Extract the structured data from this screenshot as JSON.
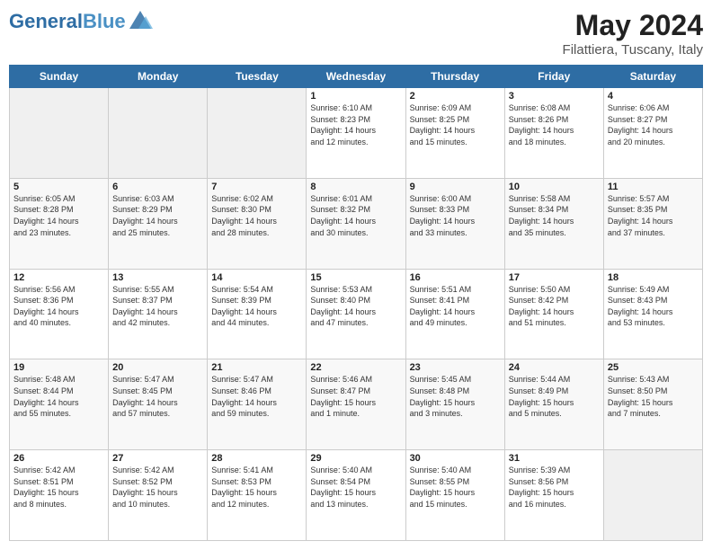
{
  "logo": {
    "part1": "General",
    "part2": "Blue"
  },
  "title": "May 2024",
  "location": "Filattiera, Tuscany, Italy",
  "days_header": [
    "Sunday",
    "Monday",
    "Tuesday",
    "Wednesday",
    "Thursday",
    "Friday",
    "Saturday"
  ],
  "weeks": [
    [
      {
        "num": "",
        "info": ""
      },
      {
        "num": "",
        "info": ""
      },
      {
        "num": "",
        "info": ""
      },
      {
        "num": "1",
        "info": "Sunrise: 6:10 AM\nSunset: 8:23 PM\nDaylight: 14 hours\nand 12 minutes."
      },
      {
        "num": "2",
        "info": "Sunrise: 6:09 AM\nSunset: 8:25 PM\nDaylight: 14 hours\nand 15 minutes."
      },
      {
        "num": "3",
        "info": "Sunrise: 6:08 AM\nSunset: 8:26 PM\nDaylight: 14 hours\nand 18 minutes."
      },
      {
        "num": "4",
        "info": "Sunrise: 6:06 AM\nSunset: 8:27 PM\nDaylight: 14 hours\nand 20 minutes."
      }
    ],
    [
      {
        "num": "5",
        "info": "Sunrise: 6:05 AM\nSunset: 8:28 PM\nDaylight: 14 hours\nand 23 minutes."
      },
      {
        "num": "6",
        "info": "Sunrise: 6:03 AM\nSunset: 8:29 PM\nDaylight: 14 hours\nand 25 minutes."
      },
      {
        "num": "7",
        "info": "Sunrise: 6:02 AM\nSunset: 8:30 PM\nDaylight: 14 hours\nand 28 minutes."
      },
      {
        "num": "8",
        "info": "Sunrise: 6:01 AM\nSunset: 8:32 PM\nDaylight: 14 hours\nand 30 minutes."
      },
      {
        "num": "9",
        "info": "Sunrise: 6:00 AM\nSunset: 8:33 PM\nDaylight: 14 hours\nand 33 minutes."
      },
      {
        "num": "10",
        "info": "Sunrise: 5:58 AM\nSunset: 8:34 PM\nDaylight: 14 hours\nand 35 minutes."
      },
      {
        "num": "11",
        "info": "Sunrise: 5:57 AM\nSunset: 8:35 PM\nDaylight: 14 hours\nand 37 minutes."
      }
    ],
    [
      {
        "num": "12",
        "info": "Sunrise: 5:56 AM\nSunset: 8:36 PM\nDaylight: 14 hours\nand 40 minutes."
      },
      {
        "num": "13",
        "info": "Sunrise: 5:55 AM\nSunset: 8:37 PM\nDaylight: 14 hours\nand 42 minutes."
      },
      {
        "num": "14",
        "info": "Sunrise: 5:54 AM\nSunset: 8:39 PM\nDaylight: 14 hours\nand 44 minutes."
      },
      {
        "num": "15",
        "info": "Sunrise: 5:53 AM\nSunset: 8:40 PM\nDaylight: 14 hours\nand 47 minutes."
      },
      {
        "num": "16",
        "info": "Sunrise: 5:51 AM\nSunset: 8:41 PM\nDaylight: 14 hours\nand 49 minutes."
      },
      {
        "num": "17",
        "info": "Sunrise: 5:50 AM\nSunset: 8:42 PM\nDaylight: 14 hours\nand 51 minutes."
      },
      {
        "num": "18",
        "info": "Sunrise: 5:49 AM\nSunset: 8:43 PM\nDaylight: 14 hours\nand 53 minutes."
      }
    ],
    [
      {
        "num": "19",
        "info": "Sunrise: 5:48 AM\nSunset: 8:44 PM\nDaylight: 14 hours\nand 55 minutes."
      },
      {
        "num": "20",
        "info": "Sunrise: 5:47 AM\nSunset: 8:45 PM\nDaylight: 14 hours\nand 57 minutes."
      },
      {
        "num": "21",
        "info": "Sunrise: 5:47 AM\nSunset: 8:46 PM\nDaylight: 14 hours\nand 59 minutes."
      },
      {
        "num": "22",
        "info": "Sunrise: 5:46 AM\nSunset: 8:47 PM\nDaylight: 15 hours\nand 1 minute."
      },
      {
        "num": "23",
        "info": "Sunrise: 5:45 AM\nSunset: 8:48 PM\nDaylight: 15 hours\nand 3 minutes."
      },
      {
        "num": "24",
        "info": "Sunrise: 5:44 AM\nSunset: 8:49 PM\nDaylight: 15 hours\nand 5 minutes."
      },
      {
        "num": "25",
        "info": "Sunrise: 5:43 AM\nSunset: 8:50 PM\nDaylight: 15 hours\nand 7 minutes."
      }
    ],
    [
      {
        "num": "26",
        "info": "Sunrise: 5:42 AM\nSunset: 8:51 PM\nDaylight: 15 hours\nand 8 minutes."
      },
      {
        "num": "27",
        "info": "Sunrise: 5:42 AM\nSunset: 8:52 PM\nDaylight: 15 hours\nand 10 minutes."
      },
      {
        "num": "28",
        "info": "Sunrise: 5:41 AM\nSunset: 8:53 PM\nDaylight: 15 hours\nand 12 minutes."
      },
      {
        "num": "29",
        "info": "Sunrise: 5:40 AM\nSunset: 8:54 PM\nDaylight: 15 hours\nand 13 minutes."
      },
      {
        "num": "30",
        "info": "Sunrise: 5:40 AM\nSunset: 8:55 PM\nDaylight: 15 hours\nand 15 minutes."
      },
      {
        "num": "31",
        "info": "Sunrise: 5:39 AM\nSunset: 8:56 PM\nDaylight: 15 hours\nand 16 minutes."
      },
      {
        "num": "",
        "info": ""
      }
    ]
  ]
}
